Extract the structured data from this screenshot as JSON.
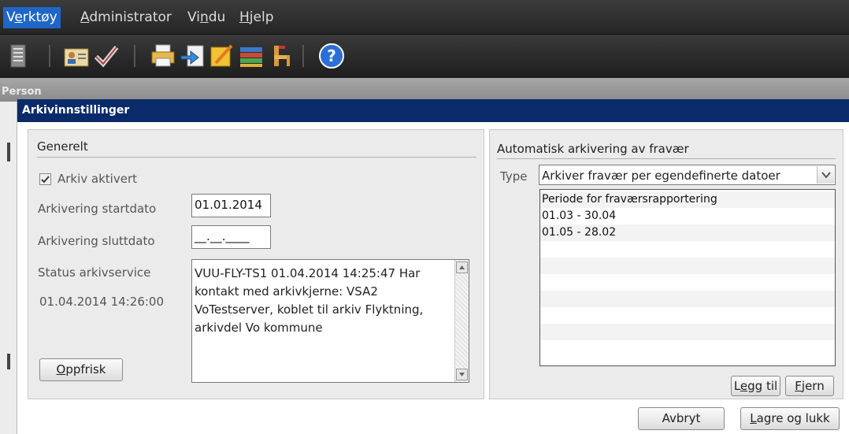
{
  "menu": {
    "items": [
      {
        "pre": "V",
        "mnemonic": "e",
        "post": "rktøy"
      },
      {
        "pre": "",
        "mnemonic": "A",
        "post": "dministrator"
      },
      {
        "pre": "Vi",
        "mnemonic": "n",
        "post": "du"
      },
      {
        "pre": "",
        "mnemonic": "H",
        "post": "jelp"
      }
    ]
  },
  "toolbar": {
    "icons": [
      "clipboard-icon",
      "person-card-icon",
      "checkmark-icon",
      "printer-icon",
      "import-arrow-icon",
      "notepad-icon",
      "books-icon",
      "chair-icon",
      "help-icon"
    ],
    "help_glyph": "?"
  },
  "person_strip": {
    "label": "Person"
  },
  "dialog": {
    "title": "Arkivinnstillinger",
    "general": {
      "title": "Generelt",
      "archive_active_label": "Arkiv aktivert",
      "archive_active_checked": true,
      "startdate_label": "Arkivering startdato",
      "startdate_value": "01.01.2014",
      "enddate_label": "Arkivering sluttdato",
      "enddate_value": "__.__.____",
      "status_label": "Status arkivservice",
      "status_time": "01.04.2014 14:26:00",
      "status_text": "VUU-FLY-TS1 01.04.2014 14:25:47 Har kontakt med arkivkjerne: VSA2 VoTestserver, koblet til arkiv Flyktning, arkivdel Vo kommune",
      "refresh_button": {
        "mnemonic": "O",
        "post": "ppfrisk"
      }
    },
    "auto": {
      "title": "Automatisk arkivering av fravær",
      "type_label": "Type",
      "type_value": "Arkiver fravær per egendefinerte datoer",
      "list_rows": [
        "Periode for fraværsrapportering",
        "01.03 - 30.04",
        "01.05 - 28.02",
        "",
        "",
        "",
        "",
        "",
        "",
        ""
      ],
      "add_button": {
        "pre": "L",
        "mnemonic": "e",
        "post": "gg til"
      },
      "remove_button": {
        "pre": "",
        "mnemonic": "F",
        "post": "jern"
      }
    },
    "cancel_button": "Avbryt",
    "save_button": {
      "pre": "",
      "mnemonic": "L",
      "post": "agre og lukk"
    }
  },
  "colors": {
    "titlebar": "#0a2a6a",
    "menu_highlight": "#1f66c8",
    "help_icon": "#2b6fd6"
  }
}
